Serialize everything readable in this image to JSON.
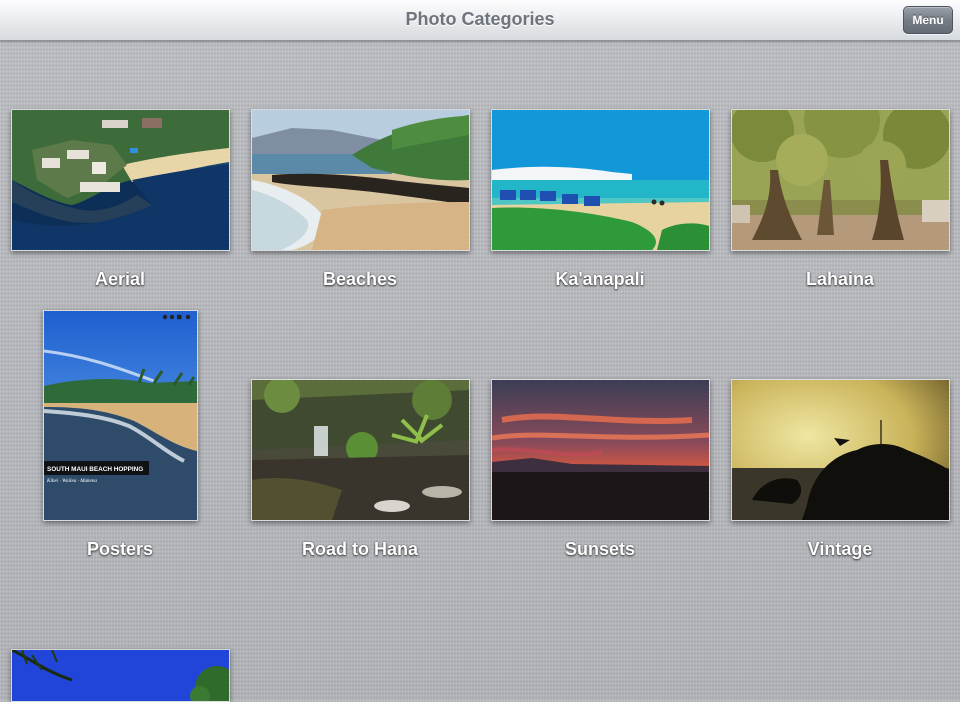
{
  "nav": {
    "title": "Photo Categories",
    "menu_label": "Menu"
  },
  "poster": {
    "headline": "SOUTH MAUI BEACH HOPPING",
    "subline": "Kihei · Wailea · Makena"
  },
  "categories": [
    {
      "label": "Aerial"
    },
    {
      "label": "Beaches"
    },
    {
      "label": "Ka'anapali"
    },
    {
      "label": "Lahaina"
    },
    {
      "label": "Posters"
    },
    {
      "label": "Road to Hana"
    },
    {
      "label": "Sunsets"
    },
    {
      "label": "Vintage"
    },
    {
      "label": ""
    }
  ]
}
